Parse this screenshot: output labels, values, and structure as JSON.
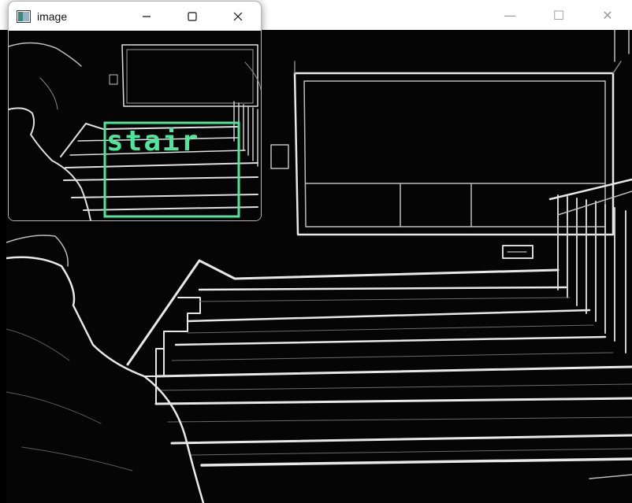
{
  "background_window": {
    "controls": {
      "minimize_glyph": "—",
      "maximize_glyph": "☐",
      "close_glyph": "✕"
    },
    "control_color": "#9a9a9a",
    "content_description_icon": "edge-detected-stairs-image"
  },
  "foreground_window": {
    "title": "image",
    "app_icon": "image-window-icon",
    "controls": {
      "minimize_glyph": "—",
      "maximize_glyph": "☐",
      "close_glyph": "✕"
    },
    "detection": {
      "label": "stair",
      "color": "#4ee59c"
    }
  },
  "colors": {
    "edge_stroke": "#e8e8e8",
    "image_background": "#050505",
    "titlebar": "#ffffff"
  }
}
